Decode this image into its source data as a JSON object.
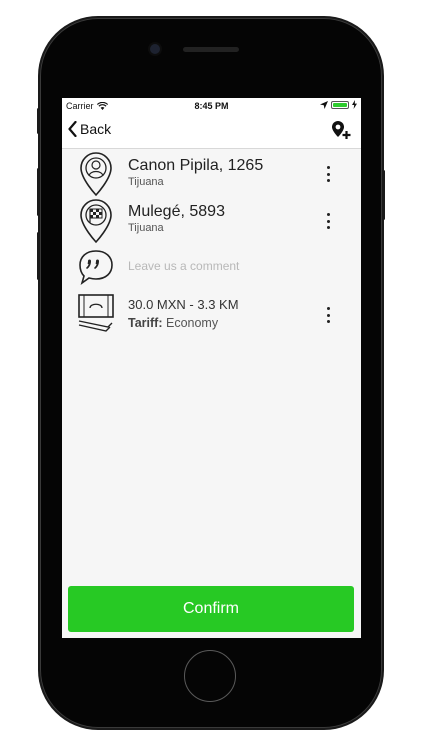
{
  "status_bar": {
    "carrier": "Carrier",
    "time": "8:45 PM",
    "battery_level": 1.0
  },
  "nav": {
    "back_label": "Back",
    "action_icon": "map-pin-add-icon"
  },
  "route": {
    "pickup": {
      "address": "Canon Pipila, 1265",
      "city": "Tijuana",
      "icon": "person-pin-icon"
    },
    "destination": {
      "address": "Mulegé, 5893",
      "city": "Tijuana",
      "icon": "checkered-flag-pin-icon"
    }
  },
  "comment": {
    "placeholder": "Leave us a comment",
    "value": "",
    "icon": "quote-bubble-icon"
  },
  "fare": {
    "summary": "30.0 MXN - 3.3 KM",
    "tariff_label": "Tariff:",
    "tariff_value": "Economy",
    "icon": "cash-icon"
  },
  "confirm_label": "Confirm",
  "colors": {
    "confirm": "#27c924",
    "battery": "#2ecc2e"
  }
}
